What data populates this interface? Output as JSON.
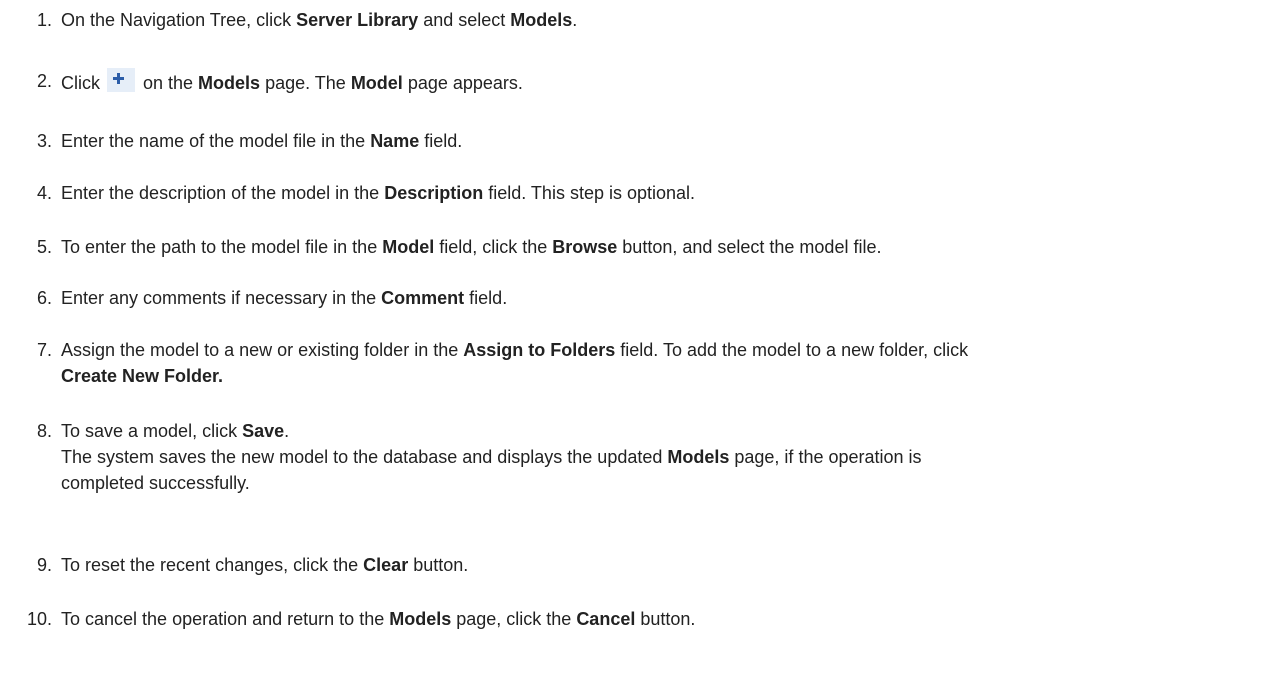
{
  "steps": [
    {
      "num": "1.",
      "lines": [
        [
          {
            "t": "On the Navigation Tree, click "
          },
          {
            "t": "Server Library",
            "b": true
          },
          {
            "t": " and select "
          },
          {
            "t": "Models",
            "b": true
          },
          {
            "t": "."
          }
        ]
      ]
    },
    {
      "num": "2.",
      "lines": [
        [
          {
            "t": "Click "
          },
          {
            "icon": "add-icon"
          },
          {
            "t": " on the "
          },
          {
            "t": "Models",
            "b": true
          },
          {
            "t": " page. The "
          },
          {
            "t": "Model",
            "b": true
          },
          {
            "t": " page appears."
          }
        ]
      ]
    },
    {
      "num": "3.",
      "lines": [
        [
          {
            "t": "Enter the name of the model file in the "
          },
          {
            "t": "Name",
            "b": true
          },
          {
            "t": " field."
          }
        ]
      ]
    },
    {
      "num": "4.",
      "lines": [
        [
          {
            "t": "Enter the description of the model in the "
          },
          {
            "t": "Description",
            "b": true
          },
          {
            "t": " field. This step is optional."
          }
        ]
      ]
    },
    {
      "num": "5.",
      "lines": [
        [
          {
            "t": "To enter the path to the model file in the "
          },
          {
            "t": "Model",
            "b": true
          },
          {
            "t": " field, click the "
          },
          {
            "t": "Browse",
            "b": true
          },
          {
            "t": " button, and select the model file."
          }
        ]
      ]
    },
    {
      "num": "6.",
      "lines": [
        [
          {
            "t": "Enter any comments if necessary in the "
          },
          {
            "t": "Comment",
            "b": true
          },
          {
            "t": " field."
          }
        ]
      ]
    },
    {
      "num": "7.",
      "lines": [
        [
          {
            "t": "Assign the model to a new or existing folder in the "
          },
          {
            "t": "Assign to Folders",
            "b": true
          },
          {
            "t": " field. To add the model to a new folder, click"
          }
        ],
        [
          {
            "t": "Create New Folder.",
            "b": true
          }
        ]
      ]
    },
    {
      "num": "8.",
      "lines": [
        [
          {
            "t": "To save a model, click "
          },
          {
            "t": "Save",
            "b": true
          },
          {
            "t": "."
          }
        ],
        [
          {
            "t": "The system saves the new model to the database and displays the updated "
          },
          {
            "t": "Models",
            "b": true
          },
          {
            "t": " page, if the operation is"
          }
        ],
        [
          {
            "t": "completed successfully."
          }
        ]
      ]
    },
    {
      "num": "9.",
      "lines": [
        [
          {
            "t": "To reset the recent changes, click the "
          },
          {
            "t": "Clear",
            "b": true
          },
          {
            "t": " button."
          }
        ]
      ]
    },
    {
      "num": "10.",
      "lines": [
        [
          {
            "t": "To cancel the operation and return to the "
          },
          {
            "t": "Models",
            "b": true
          },
          {
            "t": " page, click the "
          },
          {
            "t": "Cancel",
            "b": true
          },
          {
            "t": " button."
          }
        ]
      ]
    }
  ]
}
